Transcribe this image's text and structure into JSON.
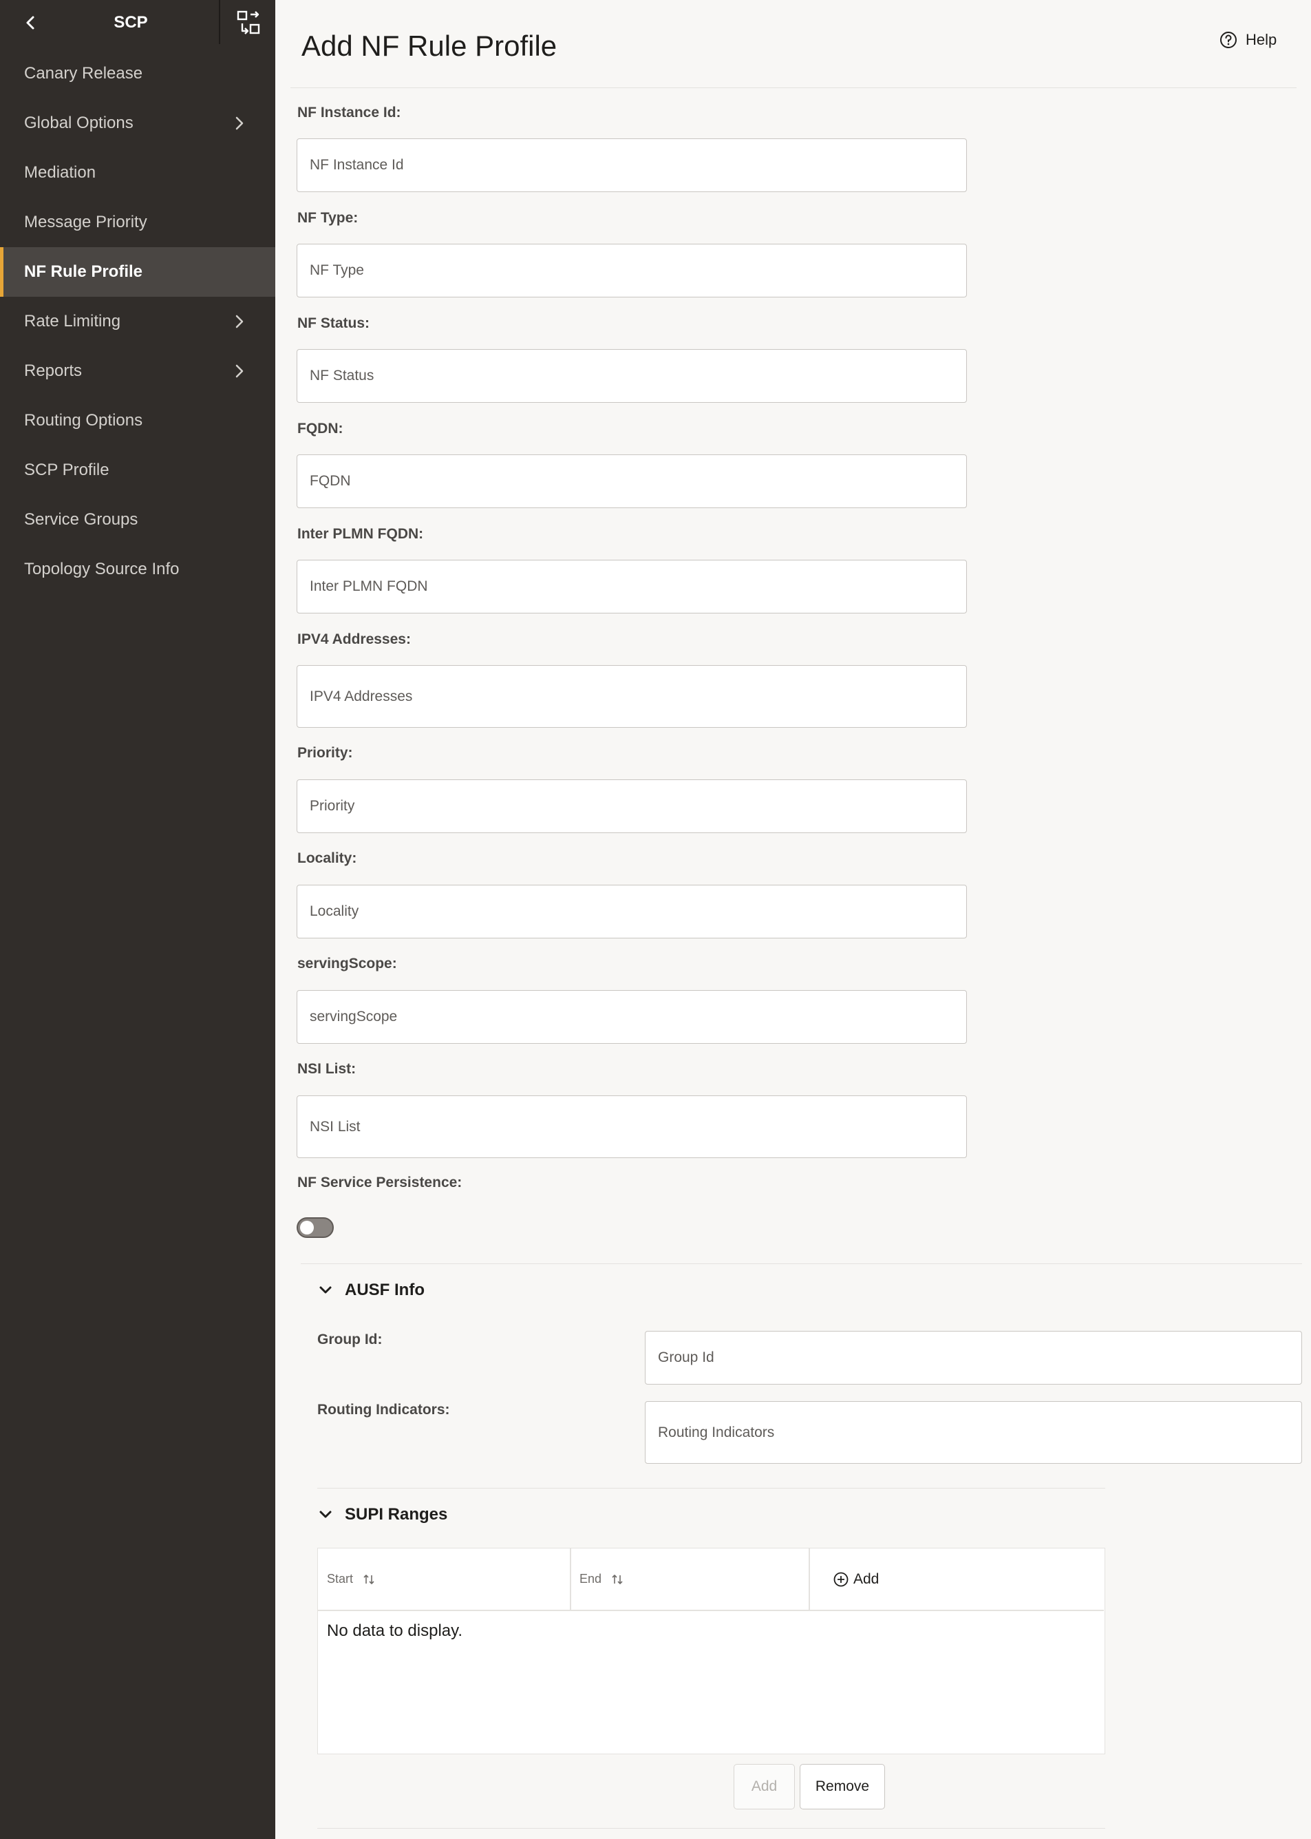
{
  "sidebar": {
    "title": "SCP",
    "items": [
      {
        "label": "Canary Release",
        "has_submenu": false,
        "active": false
      },
      {
        "label": "Global Options",
        "has_submenu": true,
        "active": false
      },
      {
        "label": "Mediation",
        "has_submenu": false,
        "active": false
      },
      {
        "label": "Message Priority",
        "has_submenu": false,
        "active": false
      },
      {
        "label": "NF Rule Profile",
        "has_submenu": false,
        "active": true
      },
      {
        "label": "Rate Limiting",
        "has_submenu": true,
        "active": false
      },
      {
        "label": "Reports",
        "has_submenu": true,
        "active": false
      },
      {
        "label": "Routing Options",
        "has_submenu": false,
        "active": false
      },
      {
        "label": "SCP Profile",
        "has_submenu": false,
        "active": false
      },
      {
        "label": "Service Groups",
        "has_submenu": false,
        "active": false
      },
      {
        "label": "Topology Source Info",
        "has_submenu": false,
        "active": false
      }
    ]
  },
  "header": {
    "title": "Add NF Rule Profile",
    "help_label": "Help"
  },
  "form": {
    "fields": [
      {
        "label": "NF Instance Id:",
        "placeholder": "NF Instance Id"
      },
      {
        "label": "NF Type:",
        "placeholder": "NF Type"
      },
      {
        "label": "NF Status:",
        "placeholder": "NF Status"
      },
      {
        "label": "FQDN:",
        "placeholder": "FQDN"
      },
      {
        "label": "Inter PLMN FQDN:",
        "placeholder": "Inter PLMN FQDN"
      },
      {
        "label": "IPV4 Addresses:",
        "placeholder": "IPV4 Addresses"
      },
      {
        "label": "Priority:",
        "placeholder": "Priority"
      },
      {
        "label": "Locality:",
        "placeholder": "Locality"
      },
      {
        "label": "servingScope:",
        "placeholder": "servingScope"
      },
      {
        "label": "NSI List:",
        "placeholder": "NSI List"
      }
    ],
    "persistence": {
      "label": "NF Service Persistence:",
      "enabled": false
    }
  },
  "ausf_info": {
    "title": "AUSF Info",
    "fields": [
      {
        "label": "Group Id:",
        "placeholder": "Group Id"
      },
      {
        "label": "Routing Indicators:",
        "placeholder": "Routing Indicators"
      }
    ]
  },
  "supi_ranges": {
    "title": "SUPI Ranges",
    "columns": [
      "Start",
      "End"
    ],
    "add_label": "Add",
    "empty_message": "No data to display.",
    "buttons": {
      "add": "Add",
      "remove": "Remove"
    }
  },
  "colors": {
    "sidebar_bg": "#312d2a",
    "active_item_bg": "#4a4643",
    "active_accent": "#e6a537",
    "page_bg": "#f8f7f5"
  }
}
